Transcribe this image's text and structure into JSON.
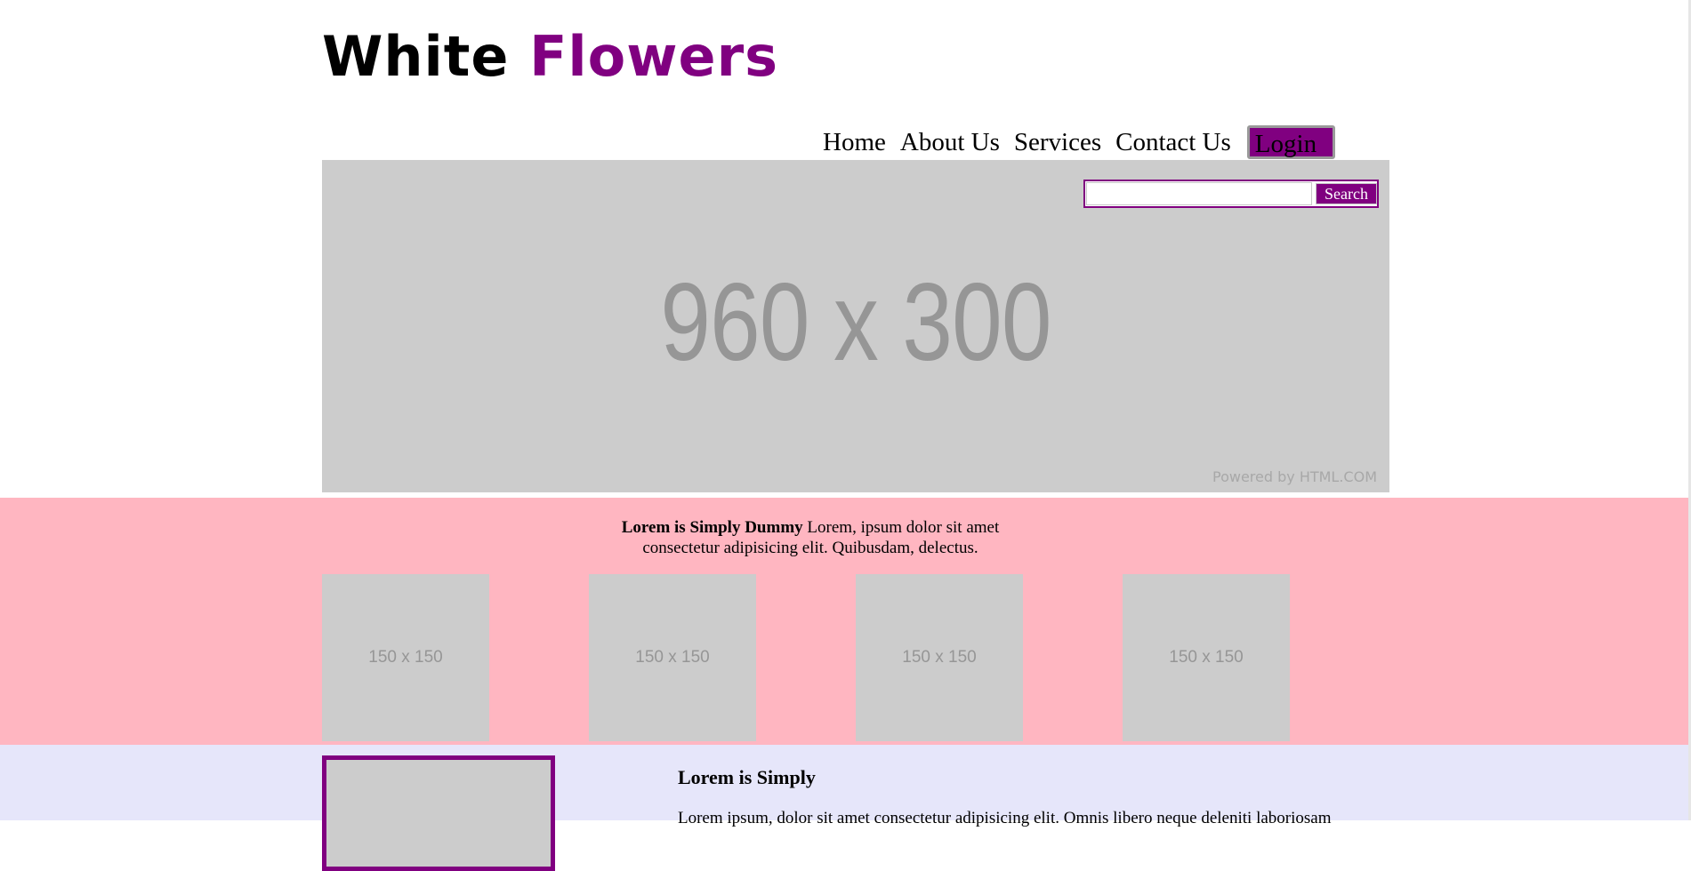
{
  "header": {
    "logo_word1": "White",
    "logo_word2": "Flowers"
  },
  "nav": {
    "items": [
      "Home",
      "About Us",
      "Services",
      "Contact Us"
    ],
    "login_label": "Login"
  },
  "search": {
    "value": "",
    "button_label": "Search"
  },
  "banner": {
    "placeholder_text": "960 x 300",
    "powered_by": "Powered by HTML.COM"
  },
  "intro": {
    "bold": "Lorem is Simply Dummy",
    "line1": " Lorem, ipsum dolor sit amet",
    "line2": "consectetur adipisicing elit. Quibusdam, delectus."
  },
  "thumbnails": [
    "150 x 150",
    "150 x 150",
    "150 x 150",
    "150 x 150"
  ],
  "feature": {
    "title": "Lorem is Simply",
    "text": "Lorem ipsum, dolor sit amet consectetur adipisicing elit. Omnis libero neque deleniti laboriosam"
  },
  "colors": {
    "accent": "#800080",
    "banner_bg": "#cccccc",
    "pink_band": "#ffb6c1",
    "lavender_band": "#e6e6fa"
  }
}
